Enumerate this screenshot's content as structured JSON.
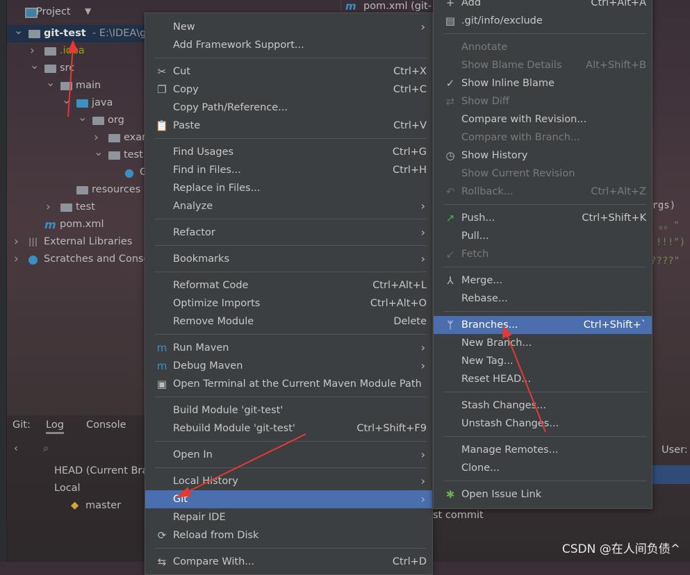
{
  "project_panel": {
    "title": "Project",
    "tree": [
      {
        "label": "git-test",
        "suffix": " - E:\\IDEA\\g",
        "level": 0,
        "open": true,
        "selected": true,
        "icon": "module-folder-icon"
      },
      {
        "label": ".idea",
        "level": 1,
        "open": false,
        "color": "#a0a000",
        "icon": "folder-icon"
      },
      {
        "label": "src",
        "level": 1,
        "open": true,
        "icon": "folder-icon"
      },
      {
        "label": "main",
        "level": 2,
        "open": true,
        "icon": "folder-icon"
      },
      {
        "label": "java",
        "level": 3,
        "open": true,
        "icon": "source-folder-icon"
      },
      {
        "label": "org",
        "level": 4,
        "open": true,
        "icon": "package-icon"
      },
      {
        "label": "exar",
        "level": 5,
        "open": false,
        "icon": "package-icon"
      },
      {
        "label": "test",
        "level": 5,
        "open": true,
        "icon": "package-icon"
      },
      {
        "label": "G",
        "level": 6,
        "icon": "java-class-icon"
      },
      {
        "label": "resources",
        "level": 3,
        "icon": "resources-folder-icon"
      },
      {
        "label": "test",
        "level": 2,
        "open": false,
        "icon": "folder-icon"
      },
      {
        "label": "pom.xml",
        "level": 1,
        "icon": "maven-icon"
      },
      {
        "label": "External Libraries",
        "level": 0,
        "open": false,
        "icon": "libraries-icon"
      },
      {
        "label": "Scratches and Conso",
        "level": 0,
        "open": false,
        "icon": "scratches-icon"
      }
    ]
  },
  "editor_tab": {
    "label": "pom.xml (git-"
  },
  "git_panel": {
    "label": "Git:",
    "tabs": [
      "Log",
      "Console"
    ],
    "branches": {
      "head": "HEAD (Current Bra",
      "local": "Local",
      "master": "master"
    },
    "user_label": "User:",
    "commit_text": "st commit"
  },
  "code_fragments": [
    "args)",
    "。。\"",
    "!!!\")",
    "????\""
  ],
  "context_menu": [
    {
      "label": "New",
      "submenu": true
    },
    {
      "label": "Add Framework Support..."
    },
    {
      "sep": true
    },
    {
      "label": "Cut",
      "shortcut": "Ctrl+X",
      "icon": "scissors-icon"
    },
    {
      "label": "Copy",
      "shortcut": "Ctrl+C",
      "icon": "copy-icon"
    },
    {
      "label": "Copy Path/Reference..."
    },
    {
      "label": "Paste",
      "shortcut": "Ctrl+V",
      "icon": "clipboard-icon"
    },
    {
      "sep": true
    },
    {
      "label": "Find Usages",
      "shortcut": "Ctrl+G"
    },
    {
      "label": "Find in Files...",
      "shortcut": "Ctrl+H"
    },
    {
      "label": "Replace in Files..."
    },
    {
      "label": "Analyze",
      "submenu": true
    },
    {
      "sep": true
    },
    {
      "label": "Refactor",
      "submenu": true
    },
    {
      "sep": true
    },
    {
      "label": "Bookmarks",
      "submenu": true
    },
    {
      "sep": true
    },
    {
      "label": "Reformat Code",
      "shortcut": "Ctrl+Alt+L"
    },
    {
      "label": "Optimize Imports",
      "shortcut": "Ctrl+Alt+O"
    },
    {
      "label": "Remove Module",
      "shortcut": "Delete"
    },
    {
      "sep": true
    },
    {
      "label": "Run Maven",
      "submenu": true,
      "icon": "maven-run-icon"
    },
    {
      "label": "Debug Maven",
      "submenu": true,
      "icon": "maven-debug-icon"
    },
    {
      "label": "Open Terminal at the Current Maven Module Path",
      "icon": "terminal-icon"
    },
    {
      "sep": true
    },
    {
      "label": "Build Module 'git-test'"
    },
    {
      "label": "Rebuild Module 'git-test'",
      "shortcut": "Ctrl+Shift+F9"
    },
    {
      "sep": true
    },
    {
      "label": "Open In",
      "submenu": true
    },
    {
      "sep": true
    },
    {
      "label": "Local History",
      "submenu": true
    },
    {
      "label": "Git",
      "submenu": true,
      "highlighted": true
    },
    {
      "label": "Repair IDE"
    },
    {
      "label": "Reload from Disk",
      "icon": "reload-icon"
    },
    {
      "sep": true
    },
    {
      "label": "Compare With...",
      "shortcut": "Ctrl+D",
      "icon": "compare-icon"
    }
  ],
  "git_submenu": [
    {
      "label": "Add",
      "shortcut": "Ctrl+Alt+A",
      "icon": "plus-icon"
    },
    {
      "label": ".git/info/exclude",
      "icon": "exclude-file-icon"
    },
    {
      "sep": true
    },
    {
      "label": "Annotate",
      "disabled": true
    },
    {
      "label": "Show Blame Details",
      "shortcut": "Alt+Shift+B",
      "disabled": true
    },
    {
      "label": "Show Inline Blame",
      "icon": "check-icon"
    },
    {
      "label": "Show Diff",
      "disabled": true,
      "icon": "diff-icon"
    },
    {
      "label": "Compare with Revision..."
    },
    {
      "label": "Compare with Branch...",
      "disabled": true
    },
    {
      "label": "Show History",
      "icon": "clock-icon"
    },
    {
      "label": "Show Current Revision",
      "disabled": true
    },
    {
      "label": "Rollback...",
      "shortcut": "Ctrl+Alt+Z",
      "disabled": true,
      "icon": "rollback-icon"
    },
    {
      "sep": true
    },
    {
      "label": "Push...",
      "shortcut": "Ctrl+Shift+K",
      "icon": "push-icon"
    },
    {
      "label": "Pull..."
    },
    {
      "label": "Fetch",
      "disabled": true,
      "icon": "fetch-icon"
    },
    {
      "sep": true
    },
    {
      "label": "Merge...",
      "icon": "merge-icon"
    },
    {
      "label": "Rebase..."
    },
    {
      "sep": true
    },
    {
      "label": "Branches...",
      "shortcut": "Ctrl+Shift+`",
      "highlighted": true,
      "icon": "branch-icon"
    },
    {
      "label": "New Branch..."
    },
    {
      "label": "New Tag..."
    },
    {
      "label": "Reset HEAD..."
    },
    {
      "sep": true
    },
    {
      "label": "Stash Changes..."
    },
    {
      "label": "Unstash Changes..."
    },
    {
      "sep": true
    },
    {
      "label": "Manage Remotes..."
    },
    {
      "label": "Clone..."
    },
    {
      "sep": true
    },
    {
      "label": "Open Issue Link",
      "icon": "bug-icon"
    }
  ],
  "watermark": "CSDN @在人间负债^",
  "colors": {
    "highlight": "#4b6eaf",
    "menu_bg": "#3c3f41",
    "annotation_arrow": "#e53935"
  }
}
